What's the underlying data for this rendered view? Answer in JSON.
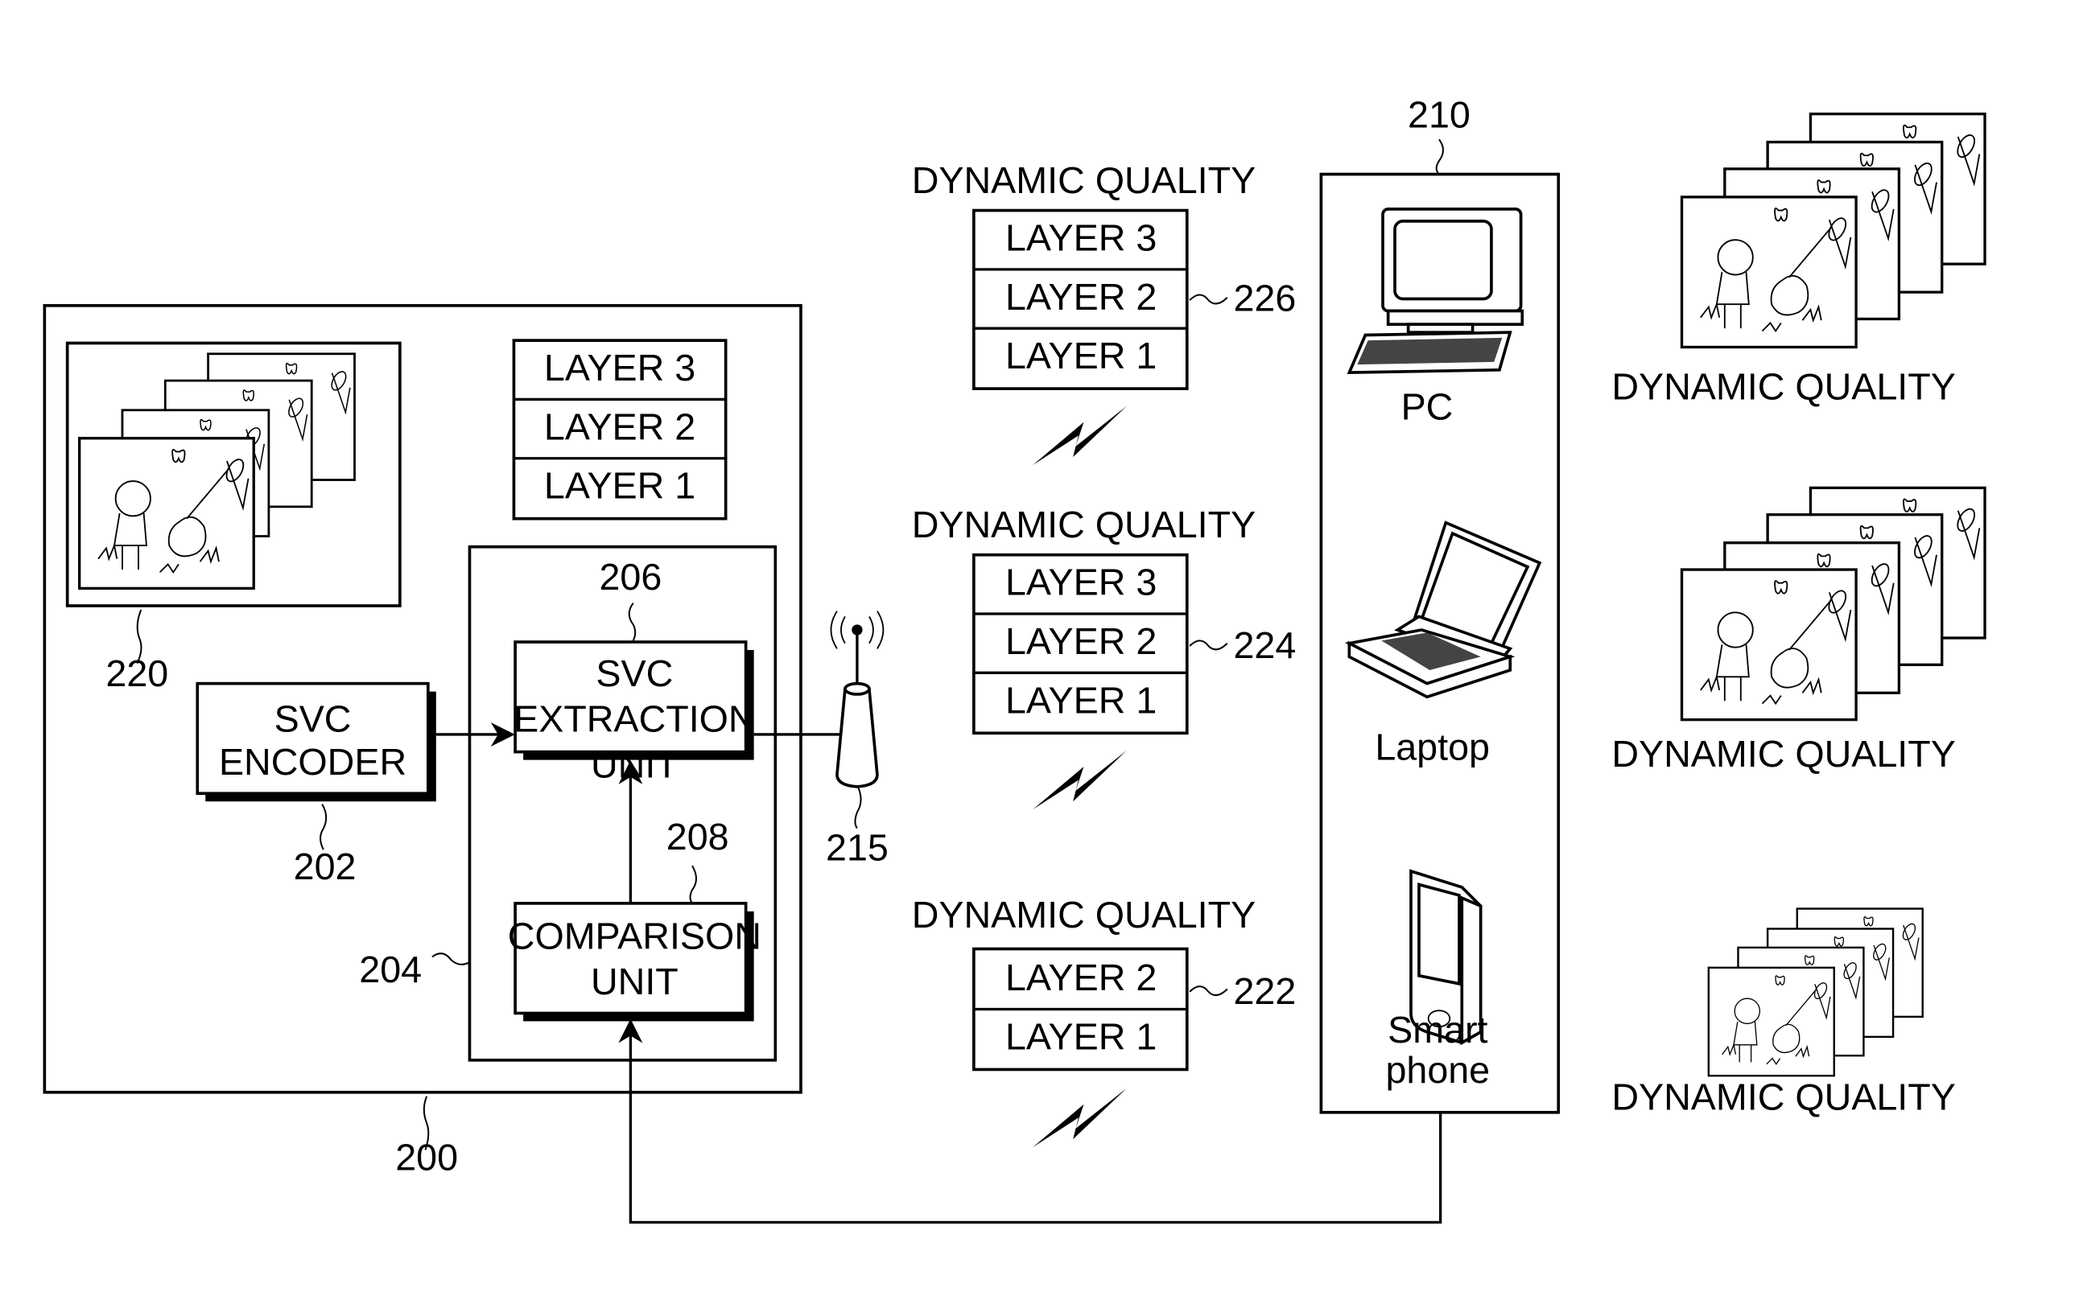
{
  "diagram": {
    "system": {
      "ref": "200"
    },
    "source_frames": {
      "ref": "220"
    },
    "encoder": {
      "line1": "SVC",
      "line2": "ENCODER",
      "ref": "202"
    },
    "controller": {
      "ref": "204"
    },
    "extraction": {
      "line1": "SVC",
      "line2": "EXTRACTION",
      "line3": "UNIT",
      "ref": "206"
    },
    "comparison": {
      "line1": "COMPARISON",
      "line2": "UNIT",
      "ref": "208"
    },
    "encoded_layers": [
      "LAYER 3",
      "LAYER 2",
      "LAYER 1"
    ],
    "antenna": {
      "ref": "215"
    },
    "streams": [
      {
        "title": "DYNAMIC QUALITY",
        "layers": [
          "LAYER 3",
          "LAYER 2",
          "LAYER 1"
        ],
        "ref": "226"
      },
      {
        "title": "DYNAMIC QUALITY",
        "layers": [
          "LAYER 3",
          "LAYER 2",
          "LAYER 1"
        ],
        "ref": "224"
      },
      {
        "title": "DYNAMIC QUALITY",
        "layers": [
          "LAYER 2",
          "LAYER 1"
        ],
        "ref": "222"
      }
    ],
    "devices_group": {
      "ref": "210"
    },
    "devices": [
      {
        "name": "PC",
        "icon": "desktop-computer-icon"
      },
      {
        "name": "Laptop",
        "icon": "laptop-icon"
      },
      {
        "name_line1": "Smart",
        "name_line2": "phone",
        "icon": "smartphone-icon"
      }
    ],
    "outputs": [
      {
        "caption": "DYNAMIC QUALITY"
      },
      {
        "caption": "DYNAMIC QUALITY"
      },
      {
        "caption": "DYNAMIC QUALITY"
      }
    ]
  }
}
